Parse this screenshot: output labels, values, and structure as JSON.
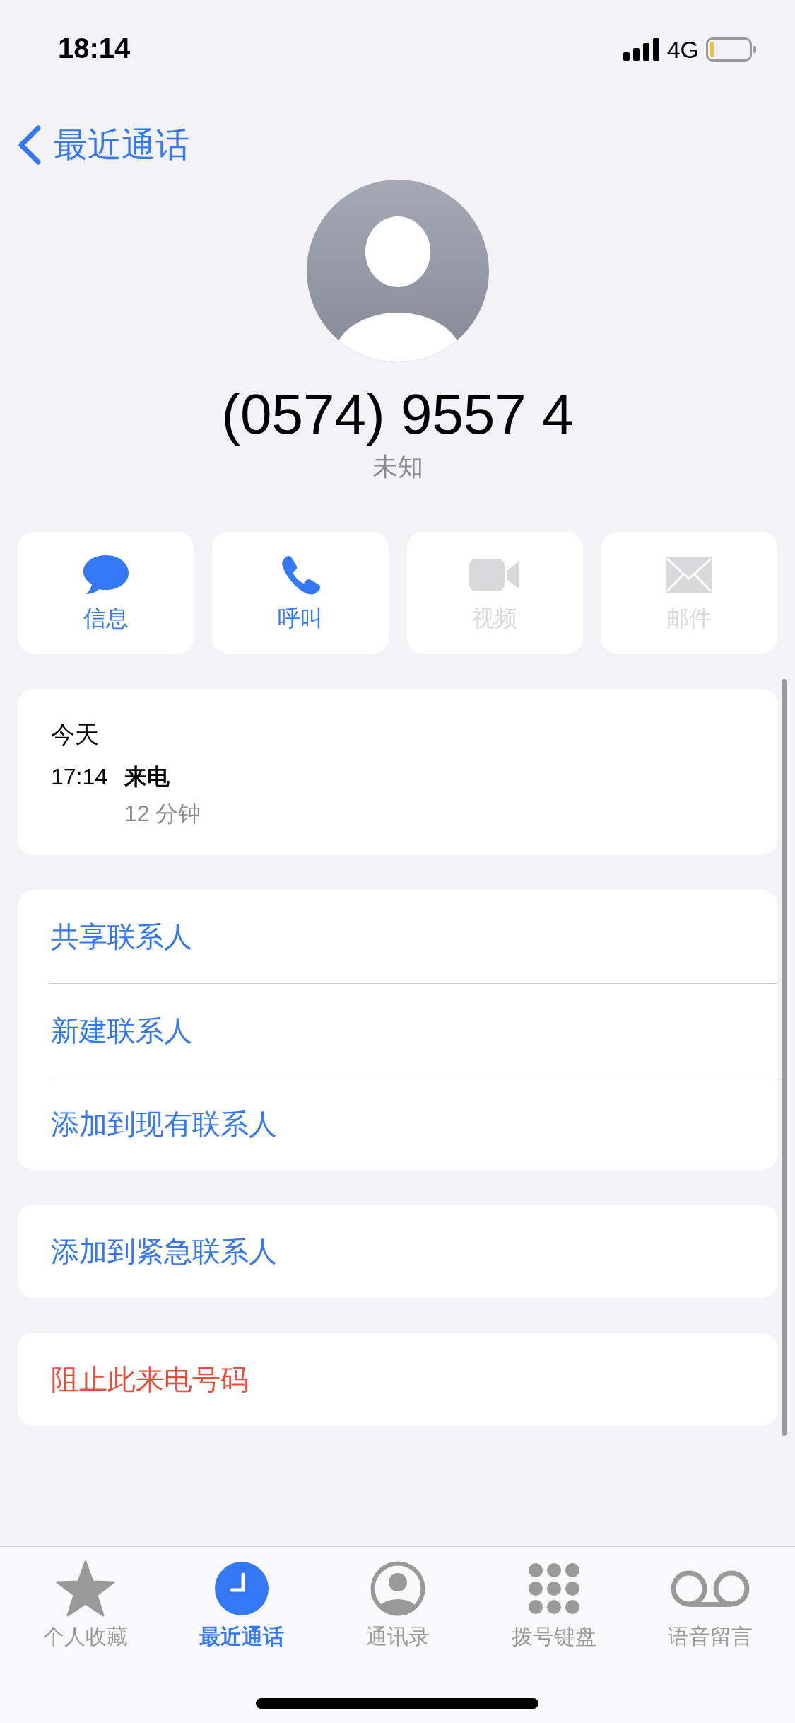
{
  "status_bar": {
    "time": "18:14",
    "network": "4G"
  },
  "nav": {
    "back_label": "最近通话"
  },
  "contact": {
    "number": "(0574) 9557 4",
    "label": "未知"
  },
  "actions": [
    {
      "kind": "message",
      "label": "信息",
      "disabled": false
    },
    {
      "kind": "call",
      "label": "呼叫",
      "disabled": false
    },
    {
      "kind": "video",
      "label": "视频",
      "disabled": true
    },
    {
      "kind": "mail",
      "label": "邮件",
      "disabled": true
    }
  ],
  "recent_calls": {
    "date": "今天",
    "entries": [
      {
        "time": "17:14",
        "type": "来电",
        "duration": "12 分钟"
      }
    ]
  },
  "menu_groups": [
    [
      {
        "label": "共享联系人",
        "destructive": false
      },
      {
        "label": "新建联系人",
        "destructive": false
      },
      {
        "label": "添加到现有联系人",
        "destructive": false
      }
    ],
    [
      {
        "label": "添加到紧急联系人",
        "destructive": false
      }
    ],
    [
      {
        "label": "阻止此来电号码",
        "destructive": true
      }
    ]
  ],
  "tabs": [
    {
      "kind": "favorites",
      "label": "个人收藏",
      "selected": false
    },
    {
      "kind": "recents",
      "label": "最近通话",
      "selected": true
    },
    {
      "kind": "contacts",
      "label": "通讯录",
      "selected": false
    },
    {
      "kind": "keypad",
      "label": "拨号键盘",
      "selected": false
    },
    {
      "kind": "voicemail",
      "label": "语音留言",
      "selected": false
    }
  ]
}
